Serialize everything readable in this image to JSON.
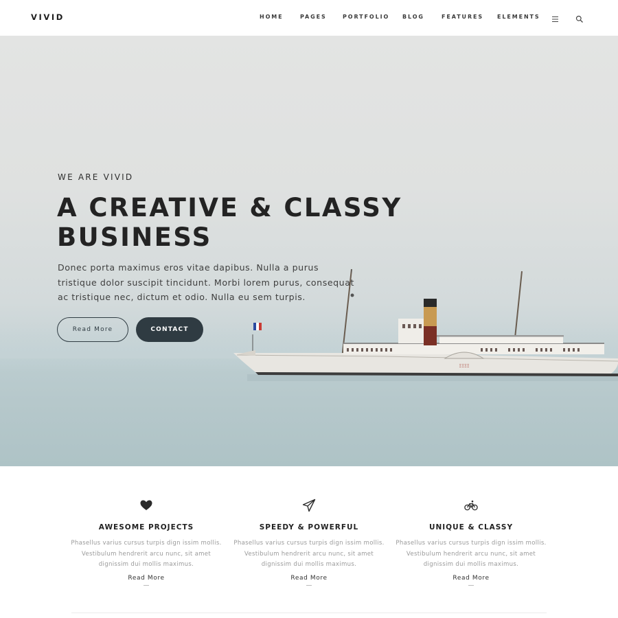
{
  "header": {
    "logo": "VIVID",
    "nav": [
      "HOME",
      "PAGES",
      "PORTFOLIO",
      "BLOG",
      "FEATURES",
      "ELEMENTS"
    ],
    "icons": [
      "menu-icon",
      "search-icon"
    ]
  },
  "hero": {
    "kicker": "WE ARE VIVID",
    "title_line1": "A CREATIVE & CLASSY",
    "title_line2": "BUSINESS",
    "text": "Donec porta maximus eros vitae dapibus. Nulla a purus tristique dolor suscipit tincidunt. Morbi lorem purus, consequat ac tristique nec, dictum et odio. Nulla eu sem turpis.",
    "buttons": {
      "primary": "Read More",
      "secondary": "CONTACT"
    },
    "ship_name": "ΞΞΞΞ"
  },
  "features": [
    {
      "icon": "heart-icon",
      "title": "AWESOME PROJECTS",
      "text": "Phasellus varius cursus turpis dign issim mollis. Vestibulum hendrerit arcu nunc, sit amet dignissim dui mollis maximus.",
      "link": "Read More"
    },
    {
      "icon": "paper-plane-icon",
      "title": "SPEEDY & POWERFUL",
      "text": "Phasellus varius cursus turpis dign issim mollis. Vestibulum hendrerit arcu nunc, sit amet dignissim dui mollis maximus.",
      "link": "Read More"
    },
    {
      "icon": "bicycle-icon",
      "title": "UNIQUE & CLASSY",
      "text": "Phasellus varius cursus turpis dign issim mollis. Vestibulum hendrerit arcu nunc, sit amet dignissim dui mollis maximus.",
      "link": "Read More"
    }
  ],
  "colors": {
    "accent": "#2f3b42",
    "text_dark": "#232323",
    "text_muted": "#9a9a9a"
  }
}
